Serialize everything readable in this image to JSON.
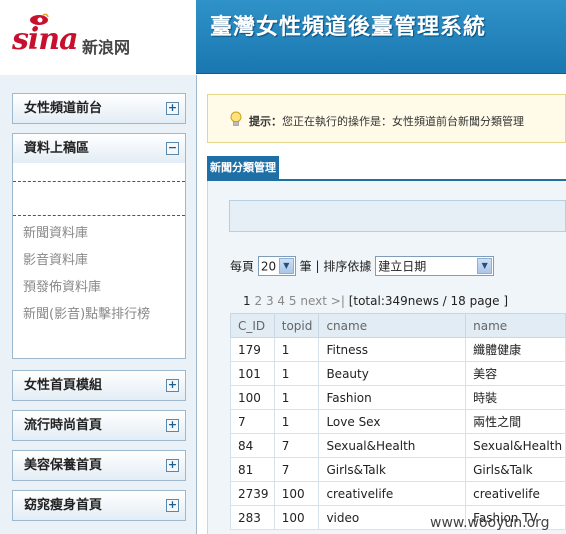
{
  "header": {
    "logo_text": "sina",
    "logo_cn": "新浪网",
    "title": "臺灣女性頻道後臺管理系統"
  },
  "sidebar": {
    "sections": [
      {
        "label": "女性頻道前台",
        "toggle": "+"
      },
      {
        "label": "資料上稿區",
        "toggle": "−"
      },
      {
        "label": "女性首頁模組",
        "toggle": "+"
      },
      {
        "label": "流行時尚首頁",
        "toggle": "+"
      },
      {
        "label": "美容保養首頁",
        "toggle": "+"
      },
      {
        "label": "窈窕瘦身首頁",
        "toggle": "+"
      }
    ],
    "links": [
      "新聞資料庫",
      "影音資料庫",
      "預發佈資料庫",
      "新聞(影音)點擊排行榜"
    ]
  },
  "notice": {
    "label": "提示：",
    "text": "您正在執行的操作是：女性頻道前台新聞分類管理"
  },
  "tab": {
    "label": "新聞分類管理"
  },
  "controls": {
    "per_page_label": "每頁",
    "per_page_value": "20",
    "per_page_unit": "筆",
    "separator": "|",
    "sort_label": "排序依據",
    "sort_value": "建立日期"
  },
  "pager": {
    "current": "1",
    "pages": [
      "2",
      "3",
      "4",
      "5"
    ],
    "next": "next",
    "last": ">|",
    "total": "[total:349news / 18 page ]"
  },
  "table": {
    "headers": [
      "C_ID",
      "topid",
      "cname",
      "name"
    ],
    "rows": [
      [
        "179",
        "1",
        "Fitness",
        "纖體健康"
      ],
      [
        "101",
        "1",
        "Beauty",
        "美容"
      ],
      [
        "100",
        "1",
        "Fashion",
        "時裝"
      ],
      [
        "7",
        "1",
        "Love Sex",
        "兩性之間"
      ],
      [
        "84",
        "7",
        "Sexual&Health",
        "Sexual&Health"
      ],
      [
        "81",
        "7",
        "Girls&Talk",
        "Girls&Talk"
      ],
      [
        "2739",
        "100",
        "creativelife",
        "creativelife"
      ],
      [
        "283",
        "100",
        "video",
        "Fashion TV"
      ]
    ]
  },
  "watermark": "www.wooyun.org"
}
